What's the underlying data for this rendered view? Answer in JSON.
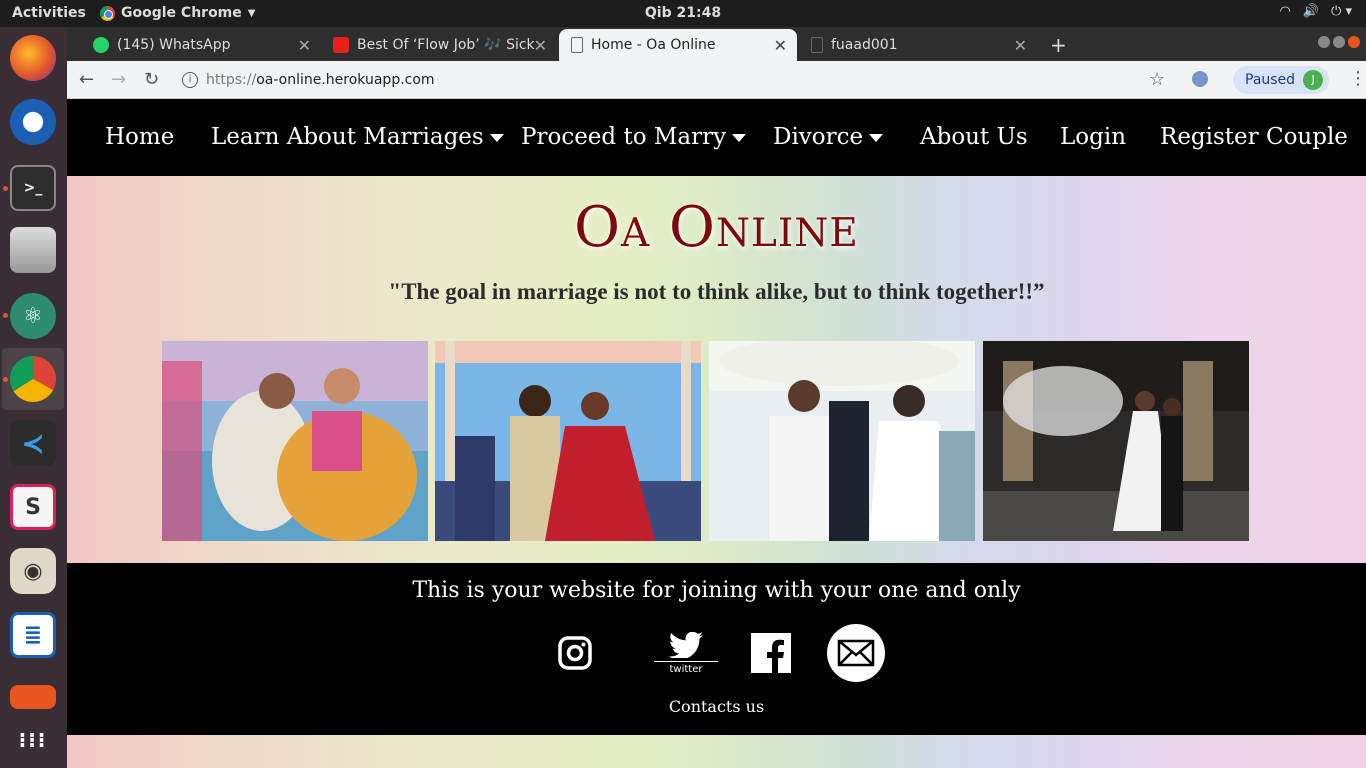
{
  "system": {
    "activities": "Activities",
    "app_menu": "Google Chrome",
    "clock": "Qib 21:48"
  },
  "browser": {
    "tabs": [
      {
        "label": "(145) WhatsApp",
        "favicon": "whatsapp-icon",
        "active": false
      },
      {
        "label": "Best Of ‘Flow Job’ 🎶 Sick",
        "favicon": "youtube-icon",
        "active": false
      },
      {
        "label": "Home - Oa Online",
        "favicon": "page-icon",
        "active": true
      },
      {
        "label": "fuaad001",
        "favicon": "page-icon",
        "active": false
      }
    ],
    "url_scheme": "https://",
    "url_host": "oa-online.herokuapp.com",
    "profile_status": "Paused",
    "profile_initial": "J"
  },
  "site": {
    "nav": [
      {
        "label": "Home",
        "dropdown": false
      },
      {
        "label": "Learn About Marriages",
        "dropdown": true
      },
      {
        "label": "Proceed to Marry",
        "dropdown": true
      },
      {
        "label": "Divorce",
        "dropdown": true
      },
      {
        "label": "About Us",
        "dropdown": false
      },
      {
        "label": "Login",
        "dropdown": false
      },
      {
        "label": "Register Couple",
        "dropdown": false
      }
    ],
    "brand": "Oa Online",
    "quote": "\"The goal in marriage is not to think alike, but to think together!!”",
    "photos": [
      "wedding-photo-1",
      "wedding-photo-2",
      "wedding-photo-3",
      "wedding-photo-4"
    ],
    "footer": {
      "tagline": "This is your website for joining with your one and only",
      "twitter_caption": "twitter",
      "contacts": "Contacts us"
    },
    "colors": {
      "brand_red": "#7d0a0a",
      "nav_bg": "#000000",
      "footer_bg": "#000000"
    }
  }
}
